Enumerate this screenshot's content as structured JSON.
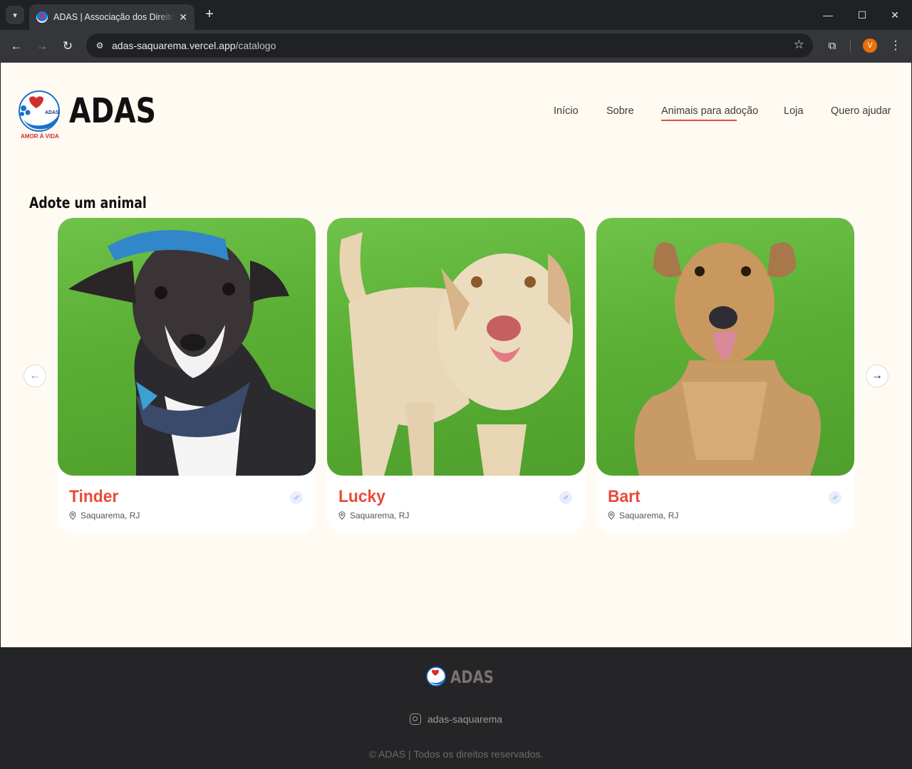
{
  "browser": {
    "tab_title": "ADAS | Associação dos Direitos",
    "url_host": "adas-saquarema.vercel.app",
    "url_path": "/catalogo",
    "profile_initial": "V"
  },
  "header": {
    "brand": "ADAS",
    "logo_text": "AMOR À VIDA",
    "nav": [
      "Início",
      "Sobre",
      "Animais para adoção",
      "Loja",
      "Quero ajudar"
    ],
    "active_nav": "Animais para adoção"
  },
  "main": {
    "section_title": "Adote um animal",
    "animals": [
      {
        "name": "Tinder",
        "location": "Saquarema, RJ",
        "gender_symbol": "♂"
      },
      {
        "name": "Lucky",
        "location": "Saquarema, RJ",
        "gender_symbol": "♂"
      },
      {
        "name": "Bart",
        "location": "Saquarema, RJ",
        "gender_symbol": "♂"
      }
    ]
  },
  "footer": {
    "brand": "ADAS",
    "instagram": "adas-saquarema",
    "copyright": "© ADAS | Todos os direitos reservados."
  },
  "colors": {
    "accent": "#e84b3c",
    "page_bg": "#fffaf2",
    "footer_bg": "#252527"
  }
}
